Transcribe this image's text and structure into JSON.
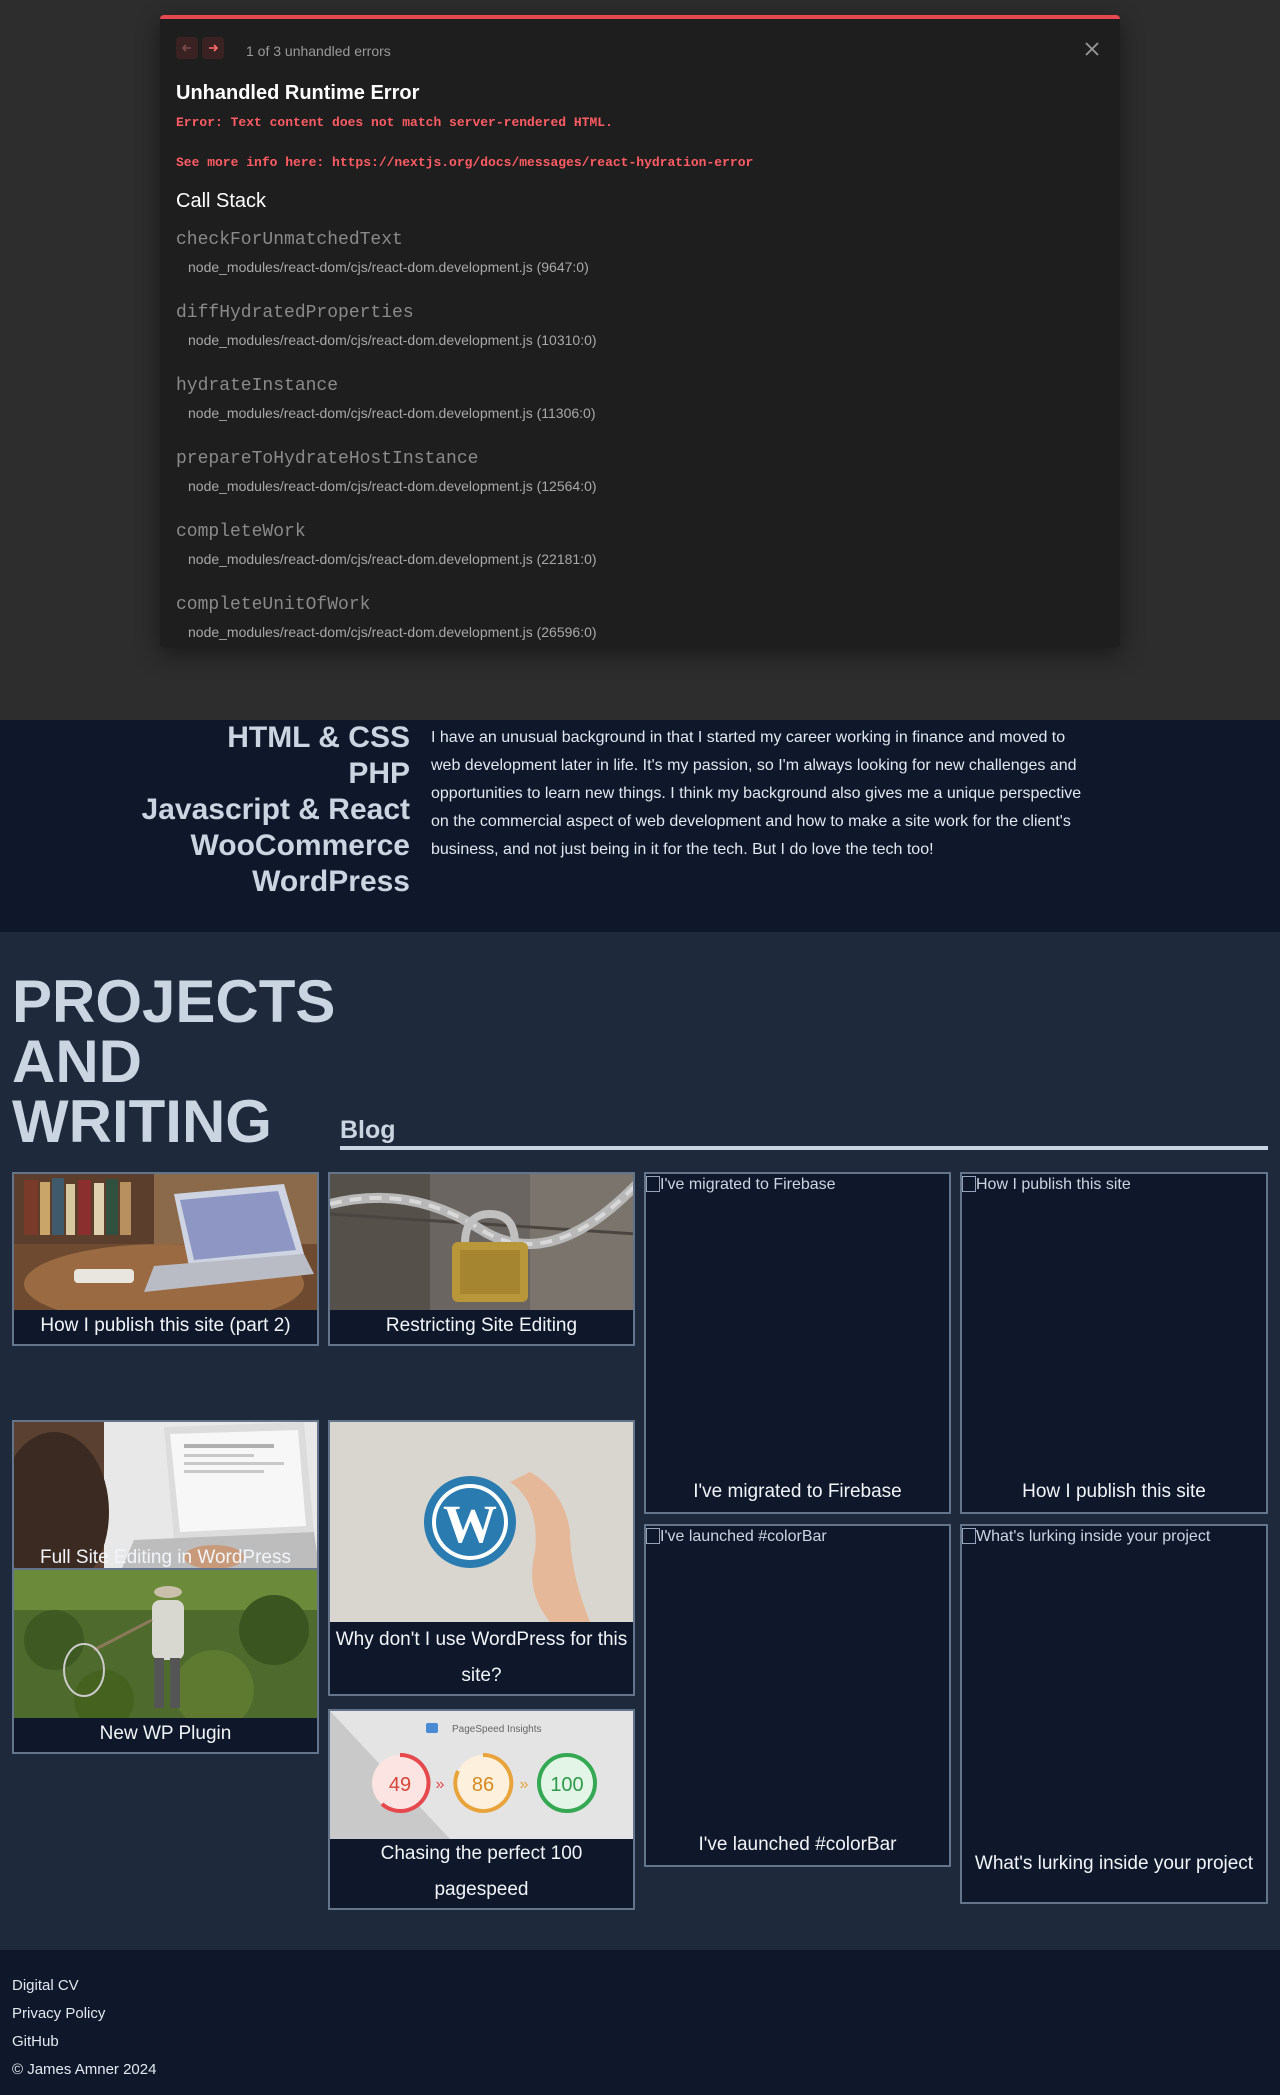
{
  "error_overlay": {
    "count_text": "1 of 3 unhandled errors",
    "title": "Unhandled Runtime Error",
    "message": "Error: Text content does not match server-rendered HTML.",
    "info_line": "See more info here: https://nextjs.org/docs/messages/react-hydration-error",
    "stack_title": "Call Stack",
    "frames": [
      {
        "fn": "checkForUnmatchedText",
        "file": "node_modules/react-dom/cjs/react-dom.development.js (9647:0)"
      },
      {
        "fn": "diffHydratedProperties",
        "file": "node_modules/react-dom/cjs/react-dom.development.js (10310:0)"
      },
      {
        "fn": "hydrateInstance",
        "file": "node_modules/react-dom/cjs/react-dom.development.js (11306:0)"
      },
      {
        "fn": "prepareToHydrateHostInstance",
        "file": "node_modules/react-dom/cjs/react-dom.development.js (12564:0)"
      },
      {
        "fn": "completeWork",
        "file": "node_modules/react-dom/cjs/react-dom.development.js (22181:0)"
      },
      {
        "fn": "completeUnitOfWork",
        "file": "node_modules/react-dom/cjs/react-dom.development.js (26596:0)"
      }
    ],
    "accent_color": "#e5484d"
  },
  "skills": {
    "items": [
      "HTML & CSS",
      "PHP",
      "Javascript & React",
      "WooCommerce",
      "WordPress"
    ],
    "bio": "I have an unusual background in that I started my career working in finance and moved to web development later in life. It's my passion, so I'm always looking for new challenges and opportunities to learn new things. I think my background also gives me a unique perspective on the commercial aspect of web development and how to make a site work for the client's business, and not just being in it for the tech. But I do love the tech too!"
  },
  "projects": {
    "heading_lines": [
      "PROJECTS",
      "AND",
      "WRITING"
    ],
    "blog_heading": "Blog",
    "cards": {
      "publish2": {
        "caption": "How I publish this site (part 2)"
      },
      "restricting": {
        "caption": "Restricting Site Editing"
      },
      "firebase": {
        "caption": "I've migrated to Firebase",
        "alt": "I've migrated to Firebase"
      },
      "publish1": {
        "caption": "How I publish this site",
        "alt": "How I publish this site"
      },
      "fse": {
        "caption": "Full Site Editing in WordPress"
      },
      "why_wp": {
        "caption": "Why don't I use WordPress for this site?"
      },
      "colorbar": {
        "caption": "I've launched #colorBar",
        "alt": "I've launched #colorBar"
      },
      "lurking": {
        "caption": "What's lurking inside your project",
        "alt": "What's lurking inside your project"
      },
      "plugin": {
        "caption": "New WP Plugin"
      },
      "pagespeed": {
        "caption": "Chasing the perfect 100 pagespeed",
        "psi_label": "PageSpeed Insights",
        "scores": [
          "49",
          "86",
          "100"
        ]
      }
    }
  },
  "footer": {
    "links": [
      "Digital CV",
      "Privacy Policy",
      "GitHub"
    ],
    "copyright": "© James Amner 2024"
  },
  "colors": {
    "page_bg": "#0f172a",
    "section_bg": "#1e293b",
    "heading": "#cbd5e1",
    "card_border": "#64748b",
    "error_text": "#ff5c63"
  }
}
